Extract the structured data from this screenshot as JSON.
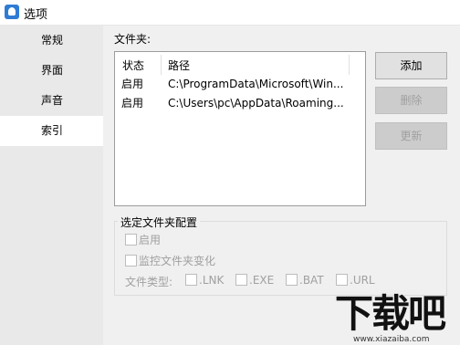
{
  "window": {
    "title": "选项"
  },
  "sidebar": {
    "items": [
      {
        "label": "常规"
      },
      {
        "label": "界面"
      },
      {
        "label": "声音"
      },
      {
        "label": "索引"
      }
    ],
    "active": "索引"
  },
  "folders": {
    "label": "文件夹:",
    "columns": [
      "状态",
      "路径"
    ],
    "rows": [
      {
        "status": "启用",
        "path": "C:\\ProgramData\\Microsoft\\Win..."
      },
      {
        "status": "启用",
        "path": "C:\\Users\\pc\\AppData\\Roaming..."
      }
    ]
  },
  "buttons": {
    "add": "添加",
    "delete": "删除",
    "update": "更新"
  },
  "config": {
    "title": "选定文件夹配置",
    "enable_label": "启用",
    "monitor_label": "监控文件夹变化",
    "filetype_label": "文件类型:",
    "types": [
      ".LNK",
      ".EXE",
      ".BAT",
      ".URL"
    ]
  },
  "watermark": {
    "main": "下载吧",
    "sub": "www.xiazaiba.com"
  }
}
